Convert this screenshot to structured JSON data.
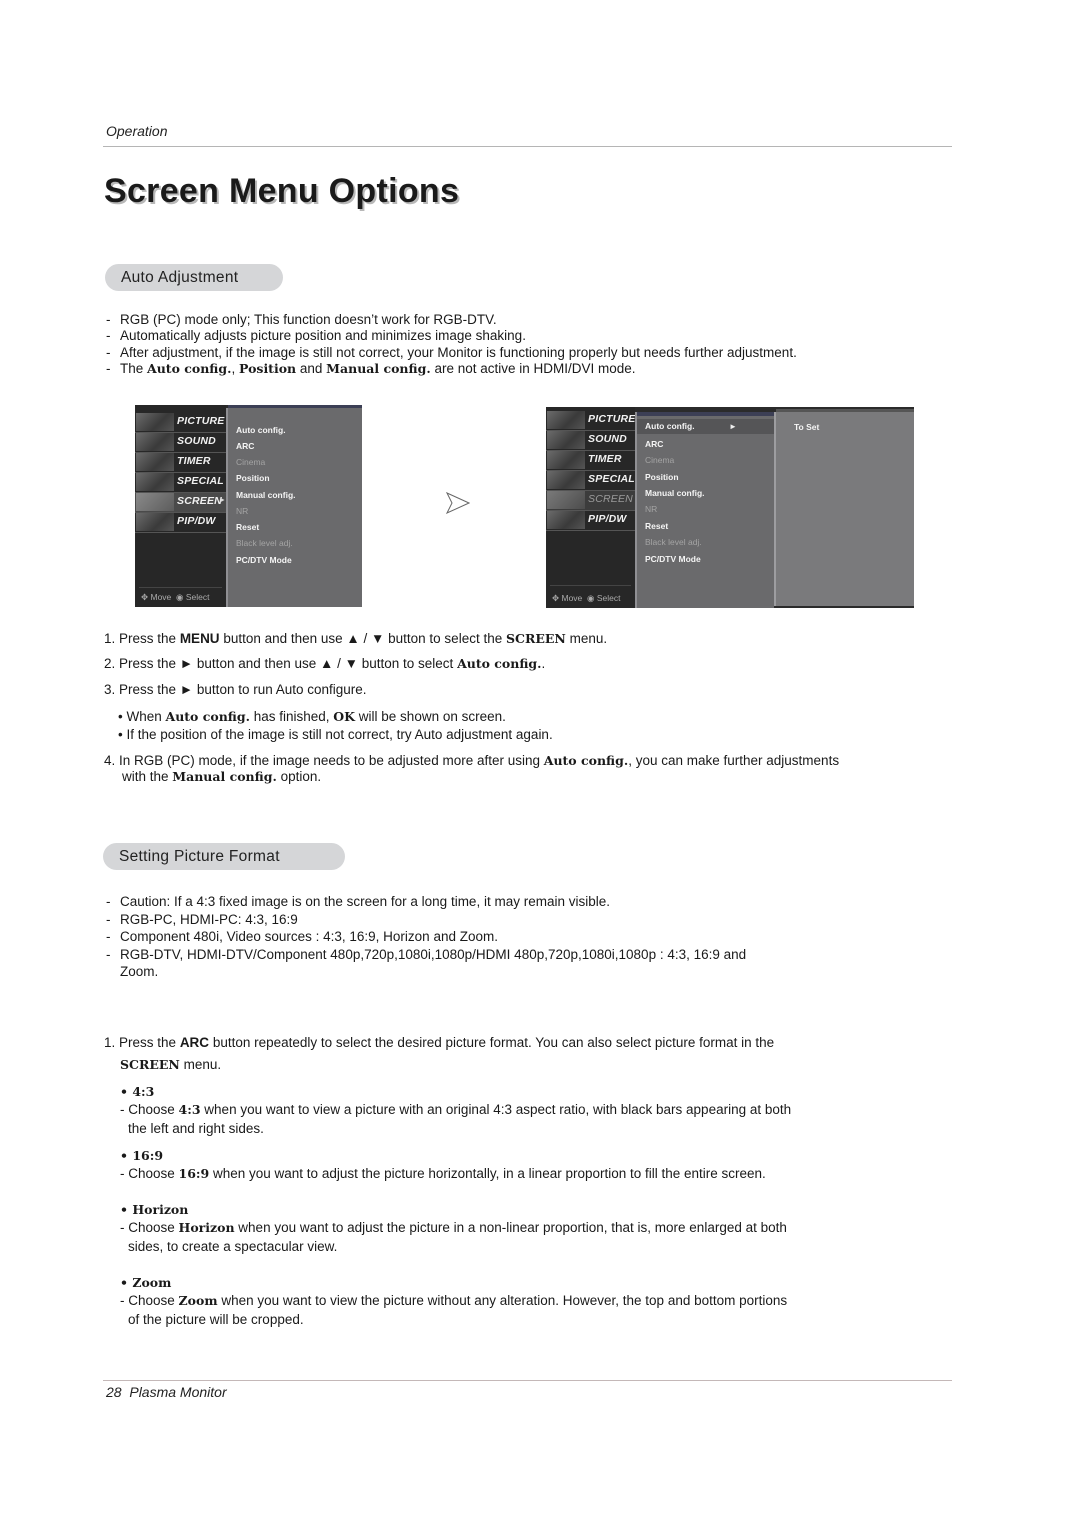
{
  "header": {
    "running_head": "Operation",
    "title": "Screen Menu Options"
  },
  "auto_adjustment": {
    "heading": "Auto Adjustment",
    "notes": [
      "RGB (PC) mode only; This function doesn’t work for RGB-DTV.",
      "Automatically adjusts picture position and minimizes image shaking.",
      "After adjustment, if the image is still not correct, your Monitor is functioning properly but needs further adjustment."
    ],
    "note4": {
      "pre": "The ",
      "b1": "Auto config.",
      "mid1": ", ",
      "b2": "Position",
      "mid2": " and ",
      "b3": "Manual config.",
      "post": " are not active in HDMI/DVI mode."
    },
    "osd_left": {
      "side_menu": [
        "PICTURE",
        "SOUND",
        "TIMER",
        "SPECIAL",
        "SCREEN",
        "PIP/DW"
      ],
      "active_side": "SCREEN",
      "footer_move": "Move",
      "footer_select": "Select",
      "items": [
        {
          "label": "Auto config.",
          "enabled": true
        },
        {
          "label": "ARC",
          "enabled": true
        },
        {
          "label": "Cinema",
          "enabled": false
        },
        {
          "label": "Position",
          "enabled": true
        },
        {
          "label": "Manual config.",
          "enabled": true
        },
        {
          "label": "NR",
          "enabled": false
        },
        {
          "label": "Reset",
          "enabled": true
        },
        {
          "label": "Black level adj.",
          "enabled": false
        },
        {
          "label": "PC/DTV Mode",
          "enabled": true
        }
      ]
    },
    "arrow_icon": "next-arrow-icon",
    "osd_right": {
      "side_menu": [
        "PICTURE",
        "SOUND",
        "TIMER",
        "SPECIAL",
        "SCREEN",
        "PIP/DW"
      ],
      "footer_move": "Move",
      "footer_select": "Select",
      "items": [
        {
          "label": "Auto config.",
          "enabled": true,
          "highlighted": true
        },
        {
          "label": "ARC",
          "enabled": true
        },
        {
          "label": "Cinema",
          "enabled": false
        },
        {
          "label": "Position",
          "enabled": true
        },
        {
          "label": "Manual config.",
          "enabled": true
        },
        {
          "label": "NR",
          "enabled": false
        },
        {
          "label": "Reset",
          "enabled": true
        },
        {
          "label": "Black level adj.",
          "enabled": false
        },
        {
          "label": "PC/DTV Mode",
          "enabled": true
        }
      ],
      "submenu_value": "To Set"
    },
    "steps": {
      "s1": {
        "num": "1.",
        "pre": "Press the ",
        "b1": "MENU",
        "mid1": " button and then use ▲ / ▼  button to select the ",
        "b2": "SCREEN",
        "post": " menu."
      },
      "s2": {
        "num": "2.",
        "pre": "Press the ► button and then use ▲ / ▼  button to select ",
        "b1": "Auto config.",
        "post": "."
      },
      "s3": {
        "num": "3.",
        "text": "Press the ► button to run Auto configure."
      },
      "bullet1": {
        "pre": "• When ",
        "b1": "Auto config.",
        "mid1": " has finished, ",
        "b2": "OK",
        "post": " will be shown on screen."
      },
      "bullet2": "• If the position of the image is still not correct, try Auto adjustment again.",
      "s4": {
        "num": "4.",
        "pre": "In RGB (PC) mode, if the image needs to be adjusted more after using ",
        "b1": "Auto config.",
        "mid1": ", you can make further adjustments",
        "line2_pre": "with the ",
        "b2": "Manual config.",
        "post": " option."
      }
    }
  },
  "picture_format": {
    "heading": "Setting Picture Format",
    "notes": [
      "Caution: If a 4:3 fixed image is on the screen for a long time, it may remain visible.",
      "RGB-PC, HDMI-PC: 4:3, 16:9",
      "Component 480i, Video sources : 4:3, 16:9, Horizon and Zoom.",
      "RGB-DTV, HDMI-DTV/Component 480p,720p,1080i,1080p/HDMI 480p,720p,1080i,1080p : 4:3, 16:9 and",
      "Zoom."
    ],
    "step1": {
      "num": "1.",
      "pre": "Press the ",
      "b1": "ARC",
      "post": " button repeatedly to select the desired picture format. You can also select picture format in the",
      "line2_b": "SCREEN",
      "line2_post": " menu."
    },
    "options": [
      {
        "title": "• 4:3",
        "pre": "- Choose ",
        "b": "4:3",
        "post": " when you want to view a picture with an original 4:3 aspect ratio, with black bars appearing at both",
        "line2": "the left and right sides."
      },
      {
        "title": "• 16:9",
        "pre": "- Choose ",
        "b": "16:9",
        "post": " when you want to adjust the picture horizontally, in a linear proportion to fill the entire screen.",
        "line2": ""
      },
      {
        "title": "• Horizon",
        "pre": "- Choose ",
        "b": "Horizon",
        "post": " when you want to adjust the picture in a non-linear proportion, that is, more enlarged at both",
        "line2": "sides, to create a spectacular view."
      },
      {
        "title": "• Zoom",
        "pre": "- Choose ",
        "b": "Zoom",
        "post": " when you want to view the picture without any alteration. However, the top and bottom portions",
        "line2": "of the picture will be cropped."
      }
    ]
  },
  "footer": {
    "page_number": "28",
    "product": "Plasma Monitor"
  }
}
